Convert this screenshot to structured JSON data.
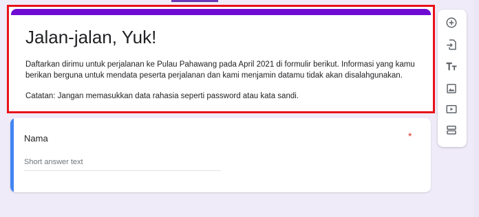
{
  "form": {
    "title": "Jalan-jalan, Yuk!",
    "description": "Daftarkan dirimu untuk perjalanan ke Pulau Pahawang pada April 2021 di formulir berikut. Informasi yang kamu berikan berguna untuk mendata peserta perjalanan dan kami menjamin datamu tidak akan disalahgunakan.",
    "note": "Catatan: Jangan memasukkan data rahasia seperti password atau kata sandi.",
    "theme_color": "#6e0bd2",
    "highlight_color": "#e8101a"
  },
  "question": {
    "title": "Nama",
    "required_mark": "*",
    "answer_placeholder": "Short answer text",
    "accent_color": "#4285f4"
  },
  "toolbar": {
    "items": [
      {
        "icon": "add-circle-icon",
        "label": "Add question"
      },
      {
        "icon": "import-icon",
        "label": "Import questions"
      },
      {
        "icon": "title-text-icon",
        "label": "Add title and description"
      },
      {
        "icon": "image-icon",
        "label": "Add image"
      },
      {
        "icon": "video-icon",
        "label": "Add video"
      },
      {
        "icon": "section-icon",
        "label": "Add section"
      }
    ]
  }
}
